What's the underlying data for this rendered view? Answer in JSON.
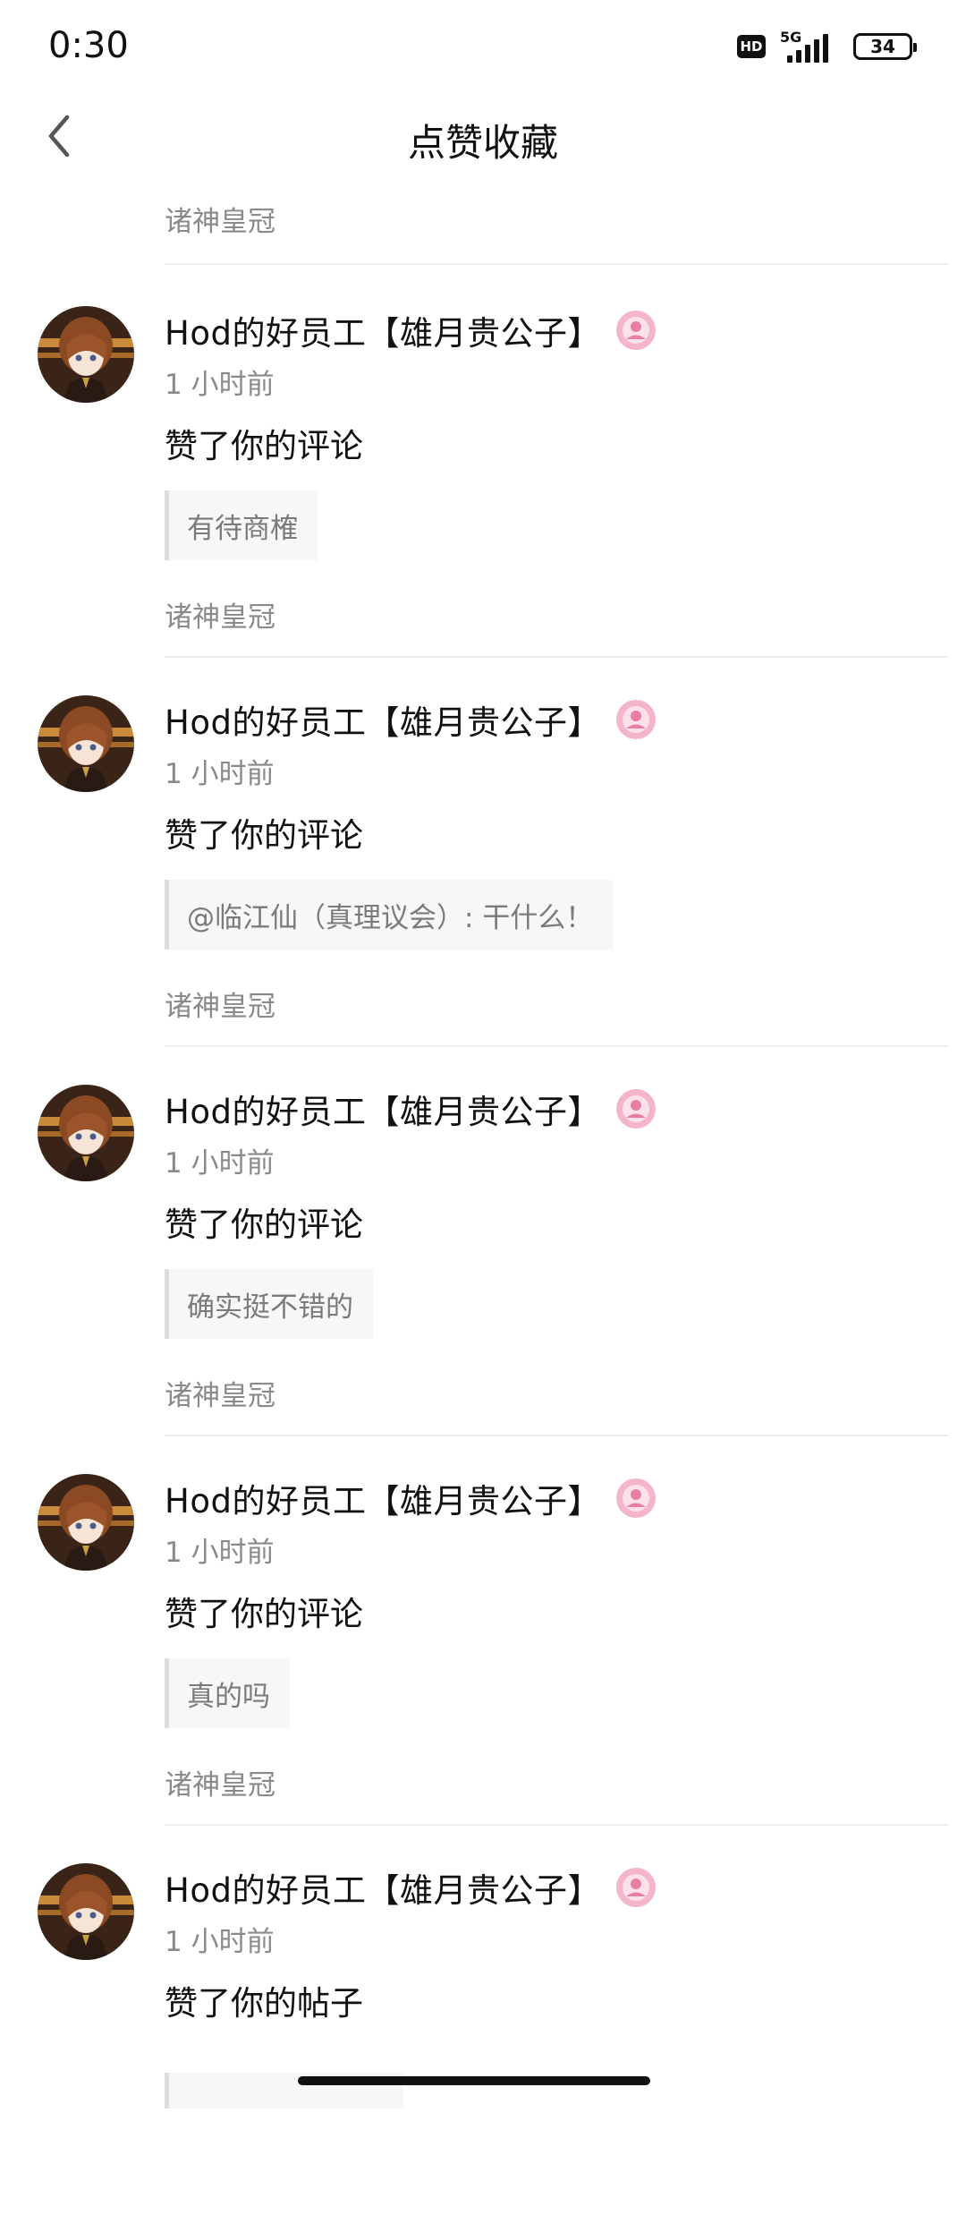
{
  "status": {
    "time": "0:30",
    "hd": "HD",
    "network": "5G",
    "battery": "34"
  },
  "header": {
    "title": "点赞收藏",
    "back_icon": "chevron-left-icon"
  },
  "top_item": {
    "source": "诸神皇冠"
  },
  "items": [
    {
      "user": "Hod的好员工【雄月贵公子】",
      "time": "1 小时前",
      "action": "赞了你的评论",
      "quote": "有待商榷",
      "source": "诸神皇冠"
    },
    {
      "user": "Hod的好员工【雄月贵公子】",
      "time": "1 小时前",
      "action": "赞了你的评论",
      "quote": "@临江仙（真理议会）: 干什么！",
      "source": "诸神皇冠"
    },
    {
      "user": "Hod的好员工【雄月贵公子】",
      "time": "1 小时前",
      "action": "赞了你的评论",
      "quote": "确实挺不错的",
      "source": "诸神皇冠"
    },
    {
      "user": "Hod的好员工【雄月贵公子】",
      "time": "1 小时前",
      "action": "赞了你的评论",
      "quote": "真的吗",
      "source": "诸神皇冠"
    },
    {
      "user": "Hod的好员工【雄月贵公子】",
      "time": "1 小时前",
      "action": "赞了你的帖子",
      "quote": "",
      "source": ""
    }
  ],
  "colors": {
    "text_primary": "#111111",
    "text_secondary": "#8a8a8a",
    "quote_bg": "#f7f7f7",
    "badge_pink": "#f2a3bd"
  }
}
